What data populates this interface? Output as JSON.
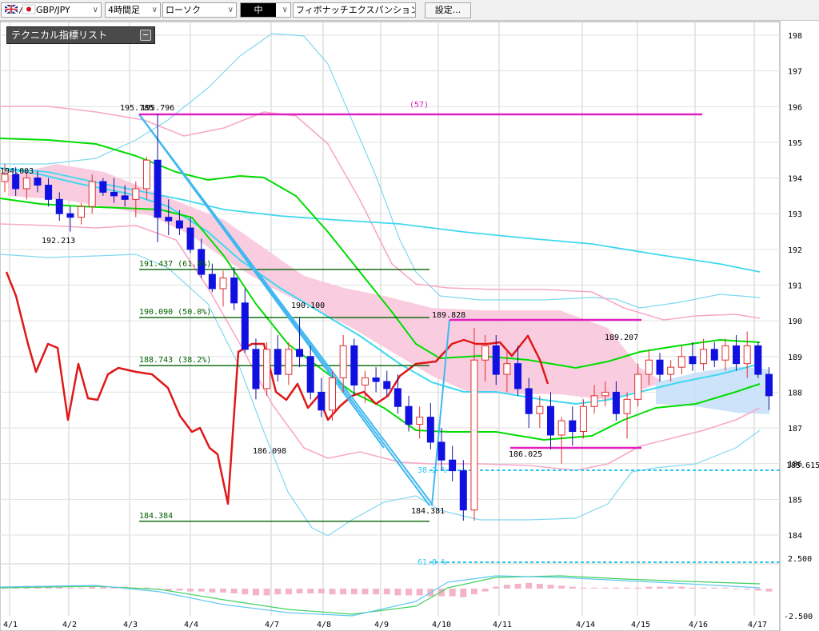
{
  "toolbar": {
    "symbol": "GBP/JPY",
    "timeframe": "4時間足",
    "chart_style": "ローソク",
    "thickness": "中",
    "drawing_tool": "フィボナッチエクスパンション",
    "settings_label": "設定..."
  },
  "indicator_panel": {
    "title": "テクニカル指標リスト"
  },
  "colors": {
    "bull": "#e03030",
    "bear": "#1010e0",
    "ma_short": "#00dd00",
    "ma_long": "#40d8f0",
    "bb_outer": "#80d8f0",
    "bb_inner": "#f8a8c8",
    "cloud_pink": "#f8c8dc",
    "cloud_blue": "#c8e0f8",
    "lagging": "#e01818",
    "fib": "#006000",
    "magenta": "#e020c0",
    "cyan_dash": "#30c8f0"
  },
  "chart_data": {
    "type": "candlestick",
    "ylim": [
      183.6,
      198.4
    ],
    "yticks": [
      "198",
      "197",
      "196",
      "195",
      "194",
      "193",
      "192",
      "191",
      "190",
      "189",
      "188",
      "187",
      "186",
      "185",
      "184"
    ],
    "current_price_label": "185.615",
    "x_labels": [
      "4/1",
      "4/2",
      "4/3",
      "4/4",
      "4/7",
      "4/8",
      "4/9",
      "4/10",
      "4/11",
      "4/14",
      "4/15",
      "4/16",
      "4/17"
    ],
    "annotations": [
      "194.003",
      "192.213",
      "195.785",
      "195.796",
      "186.098",
      "190.100",
      "189.828",
      "184.381",
      "186.025",
      "189.207"
    ],
    "fib_levels": [
      {
        "label": "191.437 (61.8%)",
        "price": 191.437
      },
      {
        "label": "190.090 (50.0%)",
        "price": 190.09
      },
      {
        "label": "188.743 (38.2%)",
        "price": 188.743
      },
      {
        "label": "184.384",
        "price": 184.384
      }
    ],
    "expansion_labels": [
      "(57)",
      "38.2 %",
      "61.8 %"
    ],
    "oscillator_ticks": [
      "2.500",
      "-2.500"
    ],
    "candles": [
      [
        193.9,
        194.4,
        193.6,
        194.1
      ],
      [
        194.1,
        194.3,
        193.5,
        193.7
      ],
      [
        193.7,
        194.2,
        193.4,
        194.0
      ],
      [
        194.0,
        194.2,
        193.6,
        193.8
      ],
      [
        193.8,
        194.0,
        193.2,
        193.4
      ],
      [
        193.4,
        193.6,
        192.8,
        193.0
      ],
      [
        193.0,
        193.2,
        192.5,
        192.9
      ],
      [
        192.9,
        193.3,
        192.7,
        193.2
      ],
      [
        193.2,
        194.1,
        193.0,
        193.9
      ],
      [
        193.9,
        194.0,
        193.5,
        193.6
      ],
      [
        193.6,
        194.0,
        193.3,
        193.5
      ],
      [
        193.5,
        193.8,
        193.2,
        193.4
      ],
      [
        193.4,
        193.9,
        192.9,
        193.7
      ],
      [
        193.7,
        194.6,
        193.4,
        194.5
      ],
      [
        194.5,
        195.8,
        192.2,
        192.9
      ],
      [
        192.9,
        193.4,
        192.4,
        192.8
      ],
      [
        192.8,
        193.1,
        192.4,
        192.6
      ],
      [
        192.6,
        192.9,
        191.9,
        192.0
      ],
      [
        192.0,
        192.3,
        191.2,
        191.3
      ],
      [
        191.3,
        191.6,
        190.8,
        190.9
      ],
      [
        190.9,
        191.4,
        190.4,
        191.2
      ],
      [
        191.2,
        191.5,
        190.3,
        190.5
      ],
      [
        190.5,
        190.9,
        189.1,
        189.2
      ],
      [
        189.2,
        189.5,
        187.8,
        188.1
      ],
      [
        188.1,
        189.4,
        187.9,
        189.2
      ],
      [
        189.2,
        189.6,
        188.3,
        188.5
      ],
      [
        188.5,
        189.4,
        188.2,
        189.2
      ],
      [
        189.2,
        190.1,
        188.7,
        189.0
      ],
      [
        189.0,
        189.3,
        187.8,
        188.0
      ],
      [
        188.0,
        188.4,
        187.3,
        187.5
      ],
      [
        187.5,
        188.6,
        187.2,
        188.4
      ],
      [
        188.4,
        189.6,
        188.0,
        189.3
      ],
      [
        189.3,
        189.5,
        187.9,
        188.2
      ],
      [
        188.2,
        188.6,
        187.7,
        188.4
      ],
      [
        188.4,
        188.7,
        188.0,
        188.3
      ],
      [
        188.3,
        188.6,
        187.9,
        188.1
      ],
      [
        188.1,
        188.5,
        187.4,
        187.6
      ],
      [
        187.6,
        187.9,
        186.9,
        187.1
      ],
      [
        187.1,
        187.6,
        186.7,
        187.3
      ],
      [
        187.3,
        187.7,
        186.4,
        186.6
      ],
      [
        186.6,
        187.0,
        185.8,
        186.1
      ],
      [
        186.1,
        186.5,
        185.5,
        185.8
      ],
      [
        185.8,
        186.1,
        184.4,
        184.7
      ],
      [
        184.7,
        189.8,
        184.4,
        188.9
      ],
      [
        188.9,
        189.6,
        188.3,
        189.3
      ],
      [
        189.3,
        189.6,
        188.2,
        188.5
      ],
      [
        188.5,
        189.2,
        188.0,
        188.8
      ],
      [
        188.8,
        189.3,
        187.9,
        188.1
      ],
      [
        188.1,
        188.4,
        187.0,
        187.4
      ],
      [
        187.4,
        187.9,
        187.0,
        187.6
      ],
      [
        187.6,
        188.0,
        186.4,
        186.8
      ],
      [
        186.8,
        187.3,
        186.0,
        187.2
      ],
      [
        187.2,
        187.6,
        186.5,
        186.9
      ],
      [
        186.9,
        187.8,
        186.7,
        187.6
      ],
      [
        187.6,
        188.2,
        187.4,
        187.9
      ],
      [
        187.9,
        188.3,
        187.6,
        188.0
      ],
      [
        188.0,
        188.3,
        187.2,
        187.4
      ],
      [
        187.4,
        188.0,
        186.7,
        187.8
      ],
      [
        187.8,
        188.8,
        187.6,
        188.5
      ],
      [
        188.5,
        189.2,
        188.2,
        188.9
      ],
      [
        188.9,
        189.1,
        188.3,
        188.5
      ],
      [
        188.5,
        188.9,
        188.3,
        188.7
      ],
      [
        188.7,
        189.3,
        188.5,
        189.0
      ],
      [
        189.0,
        189.4,
        188.6,
        188.8
      ],
      [
        188.8,
        189.5,
        188.6,
        189.2
      ],
      [
        189.2,
        189.4,
        188.7,
        188.9
      ],
      [
        188.9,
        189.5,
        188.6,
        189.3
      ],
      [
        189.3,
        189.6,
        188.6,
        188.8
      ],
      [
        188.8,
        189.7,
        188.4,
        189.3
      ],
      [
        189.3,
        189.4,
        188.4,
        188.5
      ],
      [
        188.5,
        188.7,
        187.5,
        187.9
      ]
    ]
  }
}
